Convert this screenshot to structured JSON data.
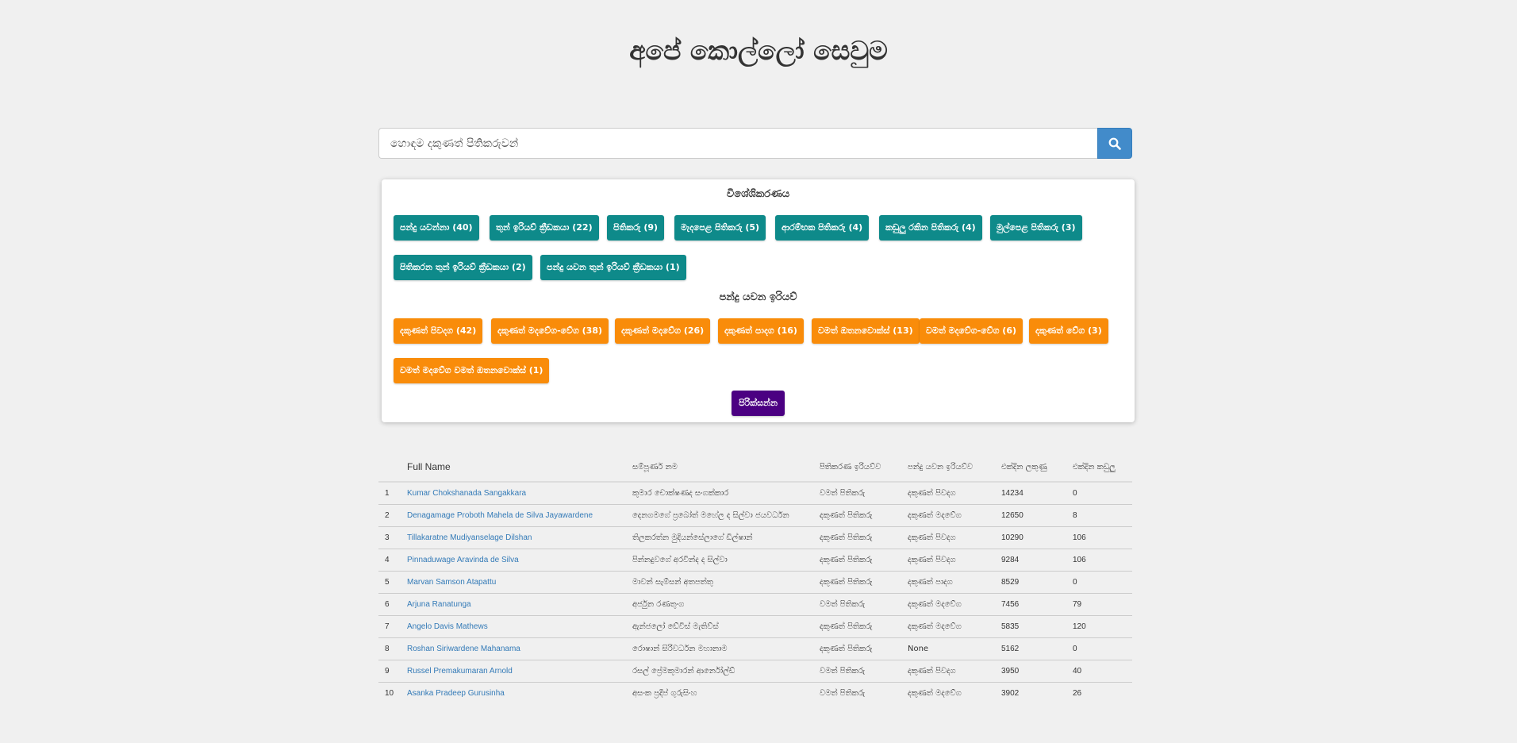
{
  "page": {
    "title": "අපේ කොල්ලෝ සෙවුම"
  },
  "search": {
    "placeholder": "හොඳම දකුණත් පිතිකරුවන්",
    "value": ""
  },
  "colors": {
    "teal": "#0e8a8a",
    "orange": "#f98c0a",
    "purple": "#4b0082",
    "search_button": "#428bca",
    "link": "#337ab7"
  },
  "facets": {
    "specialization": {
      "heading": "විශේශිකරණය",
      "items": [
        "පන්දු යවන්නා (40)",
        "තුන් ඉරියව් ක්‍රීඩකයා (22)",
        "පිතිකරු (9)",
        "මැදපෙළ පිතිකරු (5)",
        "ආරම්භක පිතිකරු (4)",
        "කඩුලු රකින පිතිකරු (4)",
        "මුල්පෙළ පිතිකරු (3)",
        "පිතිකරන තුන් ඉරියව් ක්‍රීඩකයා (2)",
        "පන්දු යවන තුන් ඉරියව් ක්‍රීඩකයා (1)"
      ]
    },
    "bowling_style": {
      "heading": "පන්දු යවන ඉරියව්",
      "items": [
        "දකුණත් පිවදග (42)",
        "දකුණත් මදවේග-වේග (38)",
        "දකුණත් මදවේග (26)",
        "දකුණත් පාදග (16)",
        "වමත් ඔතනවොක්ස් (13)",
        "වමත් මදවේග-වේග (6)",
        "දකුණත් වේග (3)",
        "වමත් මදවේග වමත් ඔතනවොක්ස් (1)"
      ]
    },
    "filter_button": "පිරික්සන්න"
  },
  "table": {
    "headers": [
      "",
      "Full Name",
      "සම්පූර්ණ නම",
      "පිතිකරණ ඉරියව්ව",
      "පන්දු යවන ඉරියව්ව",
      "එක්දින ලකුණු",
      "එක්දින කඩුලු"
    ],
    "rows": [
      [
        "1",
        "Kumar Chokshanada Sangakkara",
        "කුමාර චොක්ෂණද සංගක්කාර",
        "වමත් පිතිකරු",
        "දකුණත් පිවදග",
        "14234",
        "0"
      ],
      [
        "2",
        "Denagamage Proboth Mahela de Silva Jayawardene",
        "දෙනගමගේ ප්‍රබෝත් මහේල ද සිල්වා ජයවර්ධන",
        "දකුණත් පිතිකරු",
        "දකුණත් මදවේග",
        "12650",
        "8"
      ],
      [
        "3",
        "Tillakaratne Mudiyanselage Dilshan",
        "තිලකරත්න මුදියන්සේලාගේ ඩිල්ෂාන්",
        "දකුණත් පිතිකරු",
        "දකුණත් පිවදග",
        "10290",
        "106"
      ],
      [
        "4",
        "Pinnaduwage Aravinda de Silva",
        "පින්නදුවගේ අරවින්ද ද සිල්වා",
        "දකුණත් පිතිකරු",
        "දකුණත් පිවදග",
        "9284",
        "106"
      ],
      [
        "5",
        "Marvan Samson Atapattu",
        "මාවන් සැම්සන් අතපත්තු",
        "දකුණත් පිතිකරු",
        "දකුණත් පාදග",
        "8529",
        "0"
      ],
      [
        "6",
        "Arjuna Ranatunga",
        "අර්ජුන රණතුංග",
        "වමත් පිතිකරු",
        "දකුණත් මදවේග",
        "7456",
        "79"
      ],
      [
        "7",
        "Angelo Davis Mathews",
        "ඇන්ජලෝ ඩේවිස් මැතිව්ස්",
        "දකුණත් පිතිකරු",
        "දකුණත් මදවේග",
        "5835",
        "120"
      ],
      [
        "8",
        "Roshan Siriwardene Mahanama",
        "රොෂාන් සිරිවර්ධන මහානාම",
        "දකුණත් පිතිකරු",
        "None",
        "5162",
        "0"
      ],
      [
        "9",
        "Russel Premakumaran Arnold",
        "රසල් ප්‍රේමකුමාරන් ආර්නෝල්ඩ්",
        "වමත් පිතිකරු",
        "දකුණත් පිවදග",
        "3950",
        "40"
      ],
      [
        "10",
        "Asanka Pradeep Gurusinha",
        "අසංක ප්‍රදීප් ගුරුසිංහ",
        "වමත් පිතිකරු",
        "දකුණත් මදවේග",
        "3902",
        "26"
      ]
    ]
  }
}
